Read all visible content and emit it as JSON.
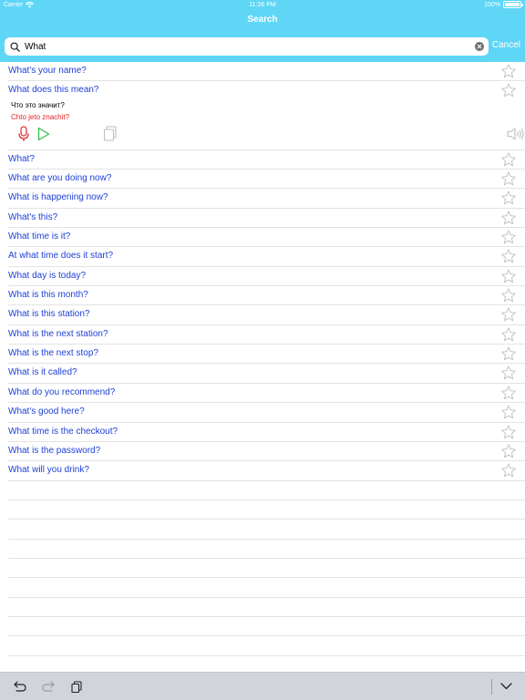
{
  "status_bar": {
    "carrier": "Carrier",
    "time": "11:26 PM",
    "battery": "100%"
  },
  "nav": {
    "title": "Search"
  },
  "search": {
    "value": "What",
    "cancel_label": "Cancel"
  },
  "phrases": [
    "What's your name?",
    "What does this mean?",
    "What?",
    "What are you doing now?",
    "What is happening now?",
    "What's this?",
    "What time is it?",
    "At what time does it start?",
    "What day is today?",
    "What is this month?",
    "What is this station?",
    "What is the next station?",
    "What is the next stop?",
    "What is it called?",
    "What do you recommend?",
    "What's good here?",
    "What time is the checkout?",
    "What is the password?",
    "What will you drink?"
  ],
  "expanded": {
    "translation": "Что это значит?",
    "transliteration": "Chto jeto znachit?"
  },
  "colors": {
    "header": "#5fd6f6",
    "phrase": "#1d3fd6",
    "transliteration": "#e0262a",
    "mic": "#e0262a",
    "play": "#33c14a",
    "star": "#bdbdbd"
  },
  "icons": {
    "search": "magnifier-icon",
    "clear": "clear-icon",
    "favorite": "star-outline-icon",
    "record": "microphone-icon",
    "play": "play-icon",
    "copy": "copy-icon",
    "speaker": "speaker-icon",
    "undo": "undo-icon",
    "redo": "redo-icon",
    "paste": "clipboard-icon",
    "dismiss_keyboard": "chevron-down-icon"
  }
}
